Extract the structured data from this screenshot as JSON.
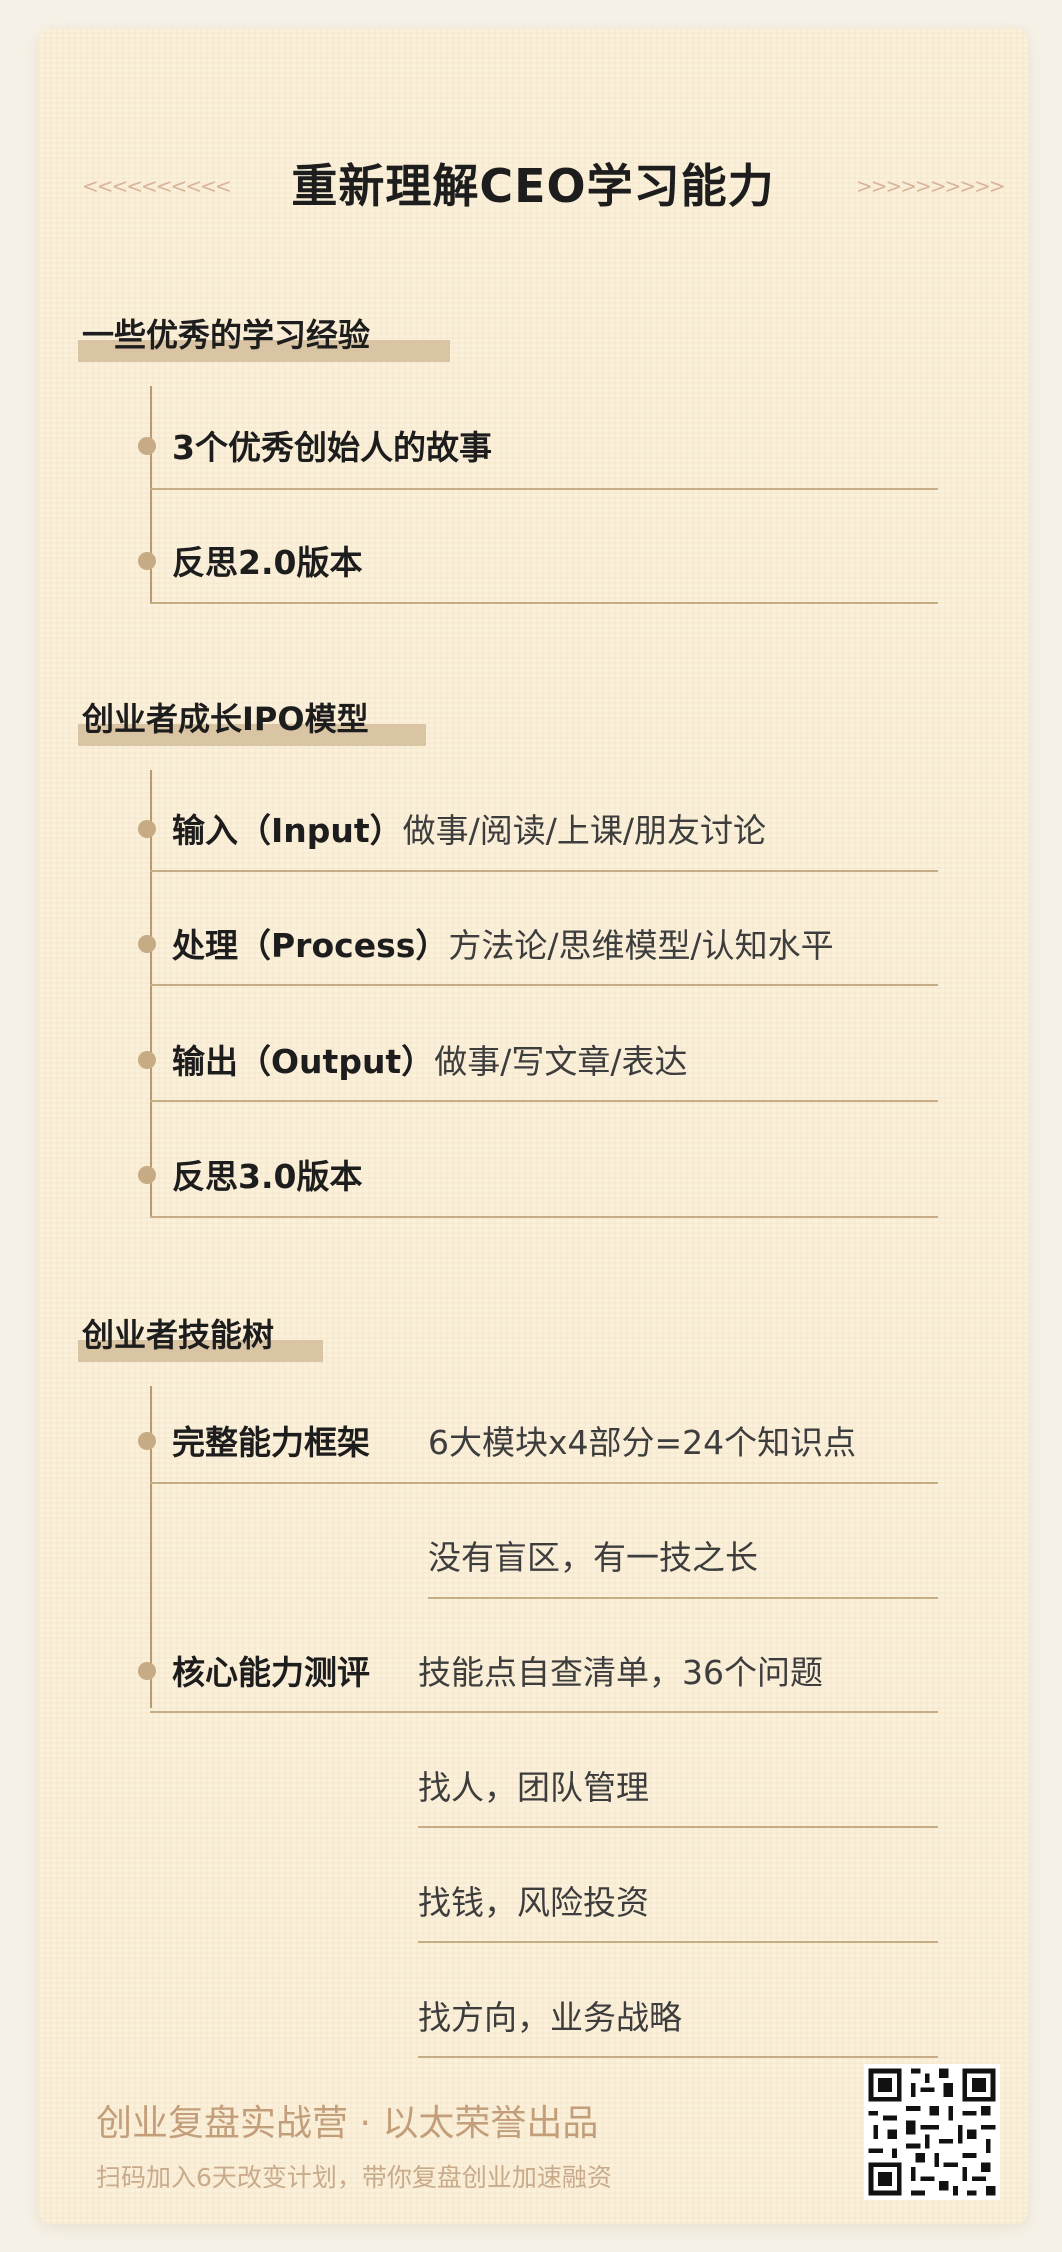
{
  "page": {
    "title": "重新理解CEO学习能力",
    "decor_left": "<<<<<<<<<<",
    "decor_right": ">>>>>>>>>>"
  },
  "sections": [
    {
      "title": "一些优秀的学习经验",
      "items": [
        {
          "label": "3个优秀创始人的故事",
          "detail": ""
        },
        {
          "label": "反思2.0版本",
          "detail": ""
        }
      ]
    },
    {
      "title": "创业者成长IPO模型",
      "items": [
        {
          "label": "输入（Input）",
          "detail": "做事/阅读/上课/朋友讨论"
        },
        {
          "label": "处理（Process）",
          "detail": "方法论/思维模型/认知水平"
        },
        {
          "label": "输出（Output）",
          "detail": "做事/写文章/表达"
        },
        {
          "label": "反思3.0版本",
          "detail": ""
        }
      ]
    },
    {
      "title": "创业者技能树",
      "items": [
        {
          "label": "完整能力框架",
          "details": [
            "6大模块x4部分=24个知识点",
            "没有盲区，有一技之长"
          ]
        },
        {
          "label": "核心能力测评",
          "details": [
            "技能点自查清单，36个问题",
            "找人，团队管理",
            "找钱，风险投资",
            "找方向，业务战略"
          ]
        }
      ]
    }
  ],
  "footer": {
    "line1": "创业复盘实战营 · 以太荣誉出品",
    "line2": "扫码加入6天改变计划，带你复盘创业加速融资",
    "qr_icon": "qr-code-icon"
  },
  "colors": {
    "background": "#fbf0da",
    "accent": "#c7ab84",
    "section_bar": "#d9c4a4",
    "footer_text": "#c29f7a"
  }
}
